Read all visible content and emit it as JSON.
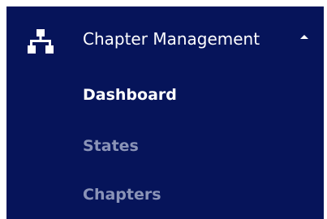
{
  "menu": {
    "header": {
      "icon": "sitemap-icon",
      "label": "Chapter Management",
      "caret": "caret-up-icon",
      "expanded": true
    },
    "items": [
      {
        "label": "Dashboard",
        "active": true
      },
      {
        "label": "States",
        "active": false
      },
      {
        "label": "Chapters",
        "active": false
      }
    ]
  },
  "colors": {
    "panel_background": "#06145a",
    "text_active": "#ffffff",
    "text_muted": "#8a93b7"
  }
}
